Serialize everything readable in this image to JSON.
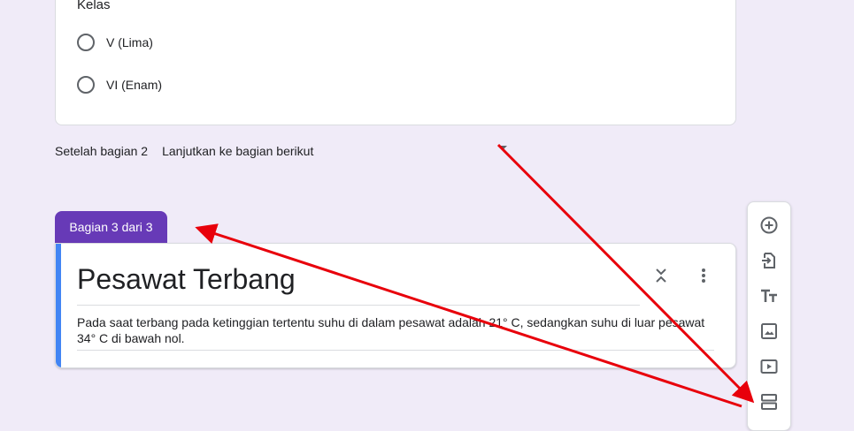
{
  "question": {
    "title": "Kelas",
    "options": [
      "V (Lima)",
      "VI (Enam)"
    ]
  },
  "after_section": {
    "label": "Setelah bagian 2",
    "value": "Lanjutkan ke bagian berikut"
  },
  "section": {
    "tab_label": "Bagian 3 dari 3",
    "title": "Pesawat Terbang",
    "description": "Pada saat terbang pada ketinggian tertentu suhu di dalam pesawat adalah 21° C, sedangkan suhu di luar pesawat 34° C di bawah nol."
  },
  "toolbar": {
    "items": [
      "add-question-icon",
      "import-questions-icon",
      "add-title-icon",
      "add-image-icon",
      "add-video-icon",
      "add-section-icon"
    ]
  },
  "colors": {
    "background": "#f0ebf8",
    "accent": "#673ab7",
    "focus": "#4285f4",
    "annotation_arrow": "#e8000b"
  }
}
